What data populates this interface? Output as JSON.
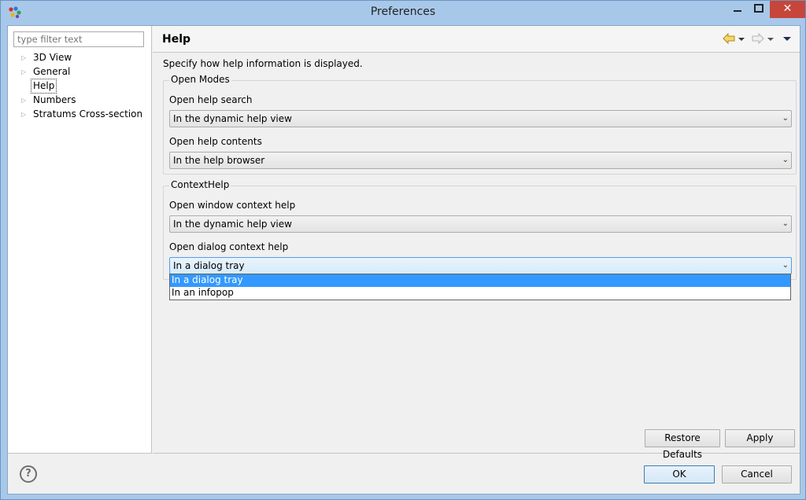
{
  "window": {
    "title": "Preferences",
    "close_glyph": "✕",
    "minimize_glyph": "—",
    "maximize_glyph": "☐"
  },
  "filter": {
    "placeholder": "type filter text"
  },
  "tree": {
    "expander_glyph": "▷",
    "items": [
      {
        "label": "3D View"
      },
      {
        "label": "General"
      },
      {
        "label": "Help"
      },
      {
        "label": "Numbers"
      },
      {
        "label": "Stratums Cross-section"
      }
    ]
  },
  "page": {
    "title": "Help",
    "description": "Specify how help information is displayed.",
    "open_modes": {
      "legend": "Open Modes",
      "search_label": "Open help search",
      "search_value": "In the dynamic help view",
      "contents_label": "Open help contents",
      "contents_value": "In the help browser"
    },
    "context_help": {
      "legend": "ContextHelp",
      "window_label": "Open window context help",
      "window_value": "In the dynamic help view",
      "dialog_label": "Open dialog context help",
      "dialog_value": "In a dialog tray"
    },
    "dropdown_options": [
      "In a dialog tray",
      "In an infopop"
    ],
    "combo_arrow": "⌄"
  },
  "buttons": {
    "restore_defaults": "Restore Defaults",
    "apply": "Apply",
    "ok": "OK",
    "cancel": "Cancel",
    "help": "?"
  },
  "icons": {
    "back": "back-arrow-icon",
    "forward": "forward-arrow-icon",
    "menu": "view-menu-icon"
  },
  "colors": {
    "selection": "#3399ff",
    "title_bar": "#a8c8ea",
    "close_button": "#c7463a"
  }
}
